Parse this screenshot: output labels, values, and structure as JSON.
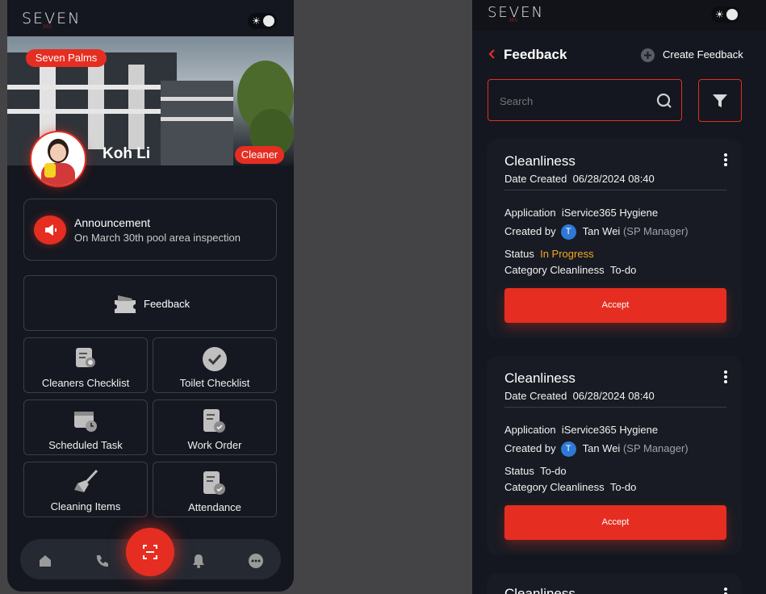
{
  "left": {
    "logo": "SEVEN",
    "logo_sub": "365",
    "location_badge": "Seven Palms",
    "user_name": "Koh Li",
    "role_badge": "Cleaner",
    "announcement": {
      "title": "Announcement",
      "text": "On March 30th pool area inspection"
    },
    "tiles": {
      "feedback": "Feedback",
      "cleaners_checklist": "Cleaners Checklist",
      "toilet_checklist": "Toilet Checklist",
      "scheduled_task": "Scheduled Task",
      "work_order": "Work Order",
      "cleaning_items": "Cleaning Items",
      "attendance": "Attendance"
    },
    "nav_icons": [
      "home-icon",
      "phone-icon",
      "scan-icon",
      "bell-icon",
      "more-icon"
    ]
  },
  "right": {
    "logo": "SEVEN",
    "logo_sub": "365",
    "title": "Feedback",
    "create_label": "Create Feedback",
    "search_placeholder": "Search",
    "cards": [
      {
        "title": "Cleanliness",
        "date_label": "Date Created",
        "date_value": "06/28/2024 08:40",
        "app_label": "Application",
        "app_value": "iService365 Hygiene",
        "created_label": "Created by",
        "creator_initial": "T",
        "creator_name": "Tan Wei",
        "creator_role": "(SP Manager)",
        "status_label": "Status",
        "status_value": "In Progress",
        "category_label": "Category Cleanliness",
        "category_value": "To-do",
        "button": "Accept"
      },
      {
        "title": "Cleanliness",
        "date_label": "Date Created",
        "date_value": "06/28/2024 08:40",
        "app_label": "Application",
        "app_value": "iService365 Hygiene",
        "created_label": "Created by",
        "creator_initial": "T",
        "creator_name": "Tan Wei",
        "creator_role": "(SP Manager)",
        "status_label": "Status",
        "status_value": "To-do",
        "category_label": "Category Cleanliness",
        "category_value": "To-do",
        "button": "Accept"
      },
      {
        "title": "Cleanliness"
      }
    ]
  },
  "colors": {
    "accent": "#e52e21",
    "background": "#14171f",
    "status_in_progress": "#f5a623"
  }
}
